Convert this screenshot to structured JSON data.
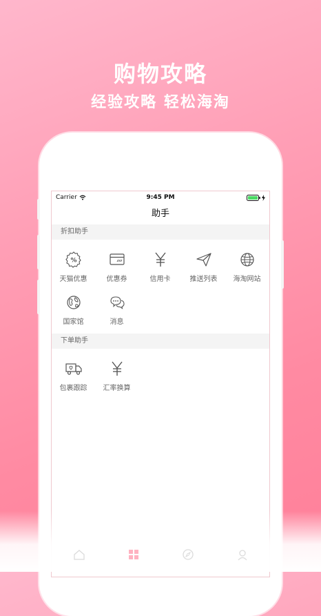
{
  "promo": {
    "title": "购物攻略",
    "subtitle": "经验攻略 轻松海淘"
  },
  "status_bar": {
    "carrier": "Carrier",
    "time": "9:45 PM"
  },
  "nav": {
    "title": "助手"
  },
  "sections": [
    {
      "header": "折扣助手",
      "items": [
        {
          "label": "天猫优惠",
          "icon": "discount-icon"
        },
        {
          "label": "优惠券",
          "icon": "coupon-card-icon"
        },
        {
          "label": "信用卡",
          "icon": "yen-icon"
        },
        {
          "label": "推送列表",
          "icon": "paper-plane-icon"
        },
        {
          "label": "海淘网站",
          "icon": "globe-icon"
        },
        {
          "label": "国家馆",
          "icon": "earth-icon"
        },
        {
          "label": "消息",
          "icon": "chat-bubbles-icon"
        }
      ]
    },
    {
      "header": "下单助手",
      "items": [
        {
          "label": "包裹跟踪",
          "icon": "delivery-truck-icon"
        },
        {
          "label": "汇率换算",
          "icon": "yen-icon"
        }
      ]
    }
  ],
  "colors": {
    "background_pink": "#ff8aa2",
    "battery_green": "#4cd964",
    "icon_stroke": "#555555",
    "section_bg": "#f4f4f4"
  }
}
